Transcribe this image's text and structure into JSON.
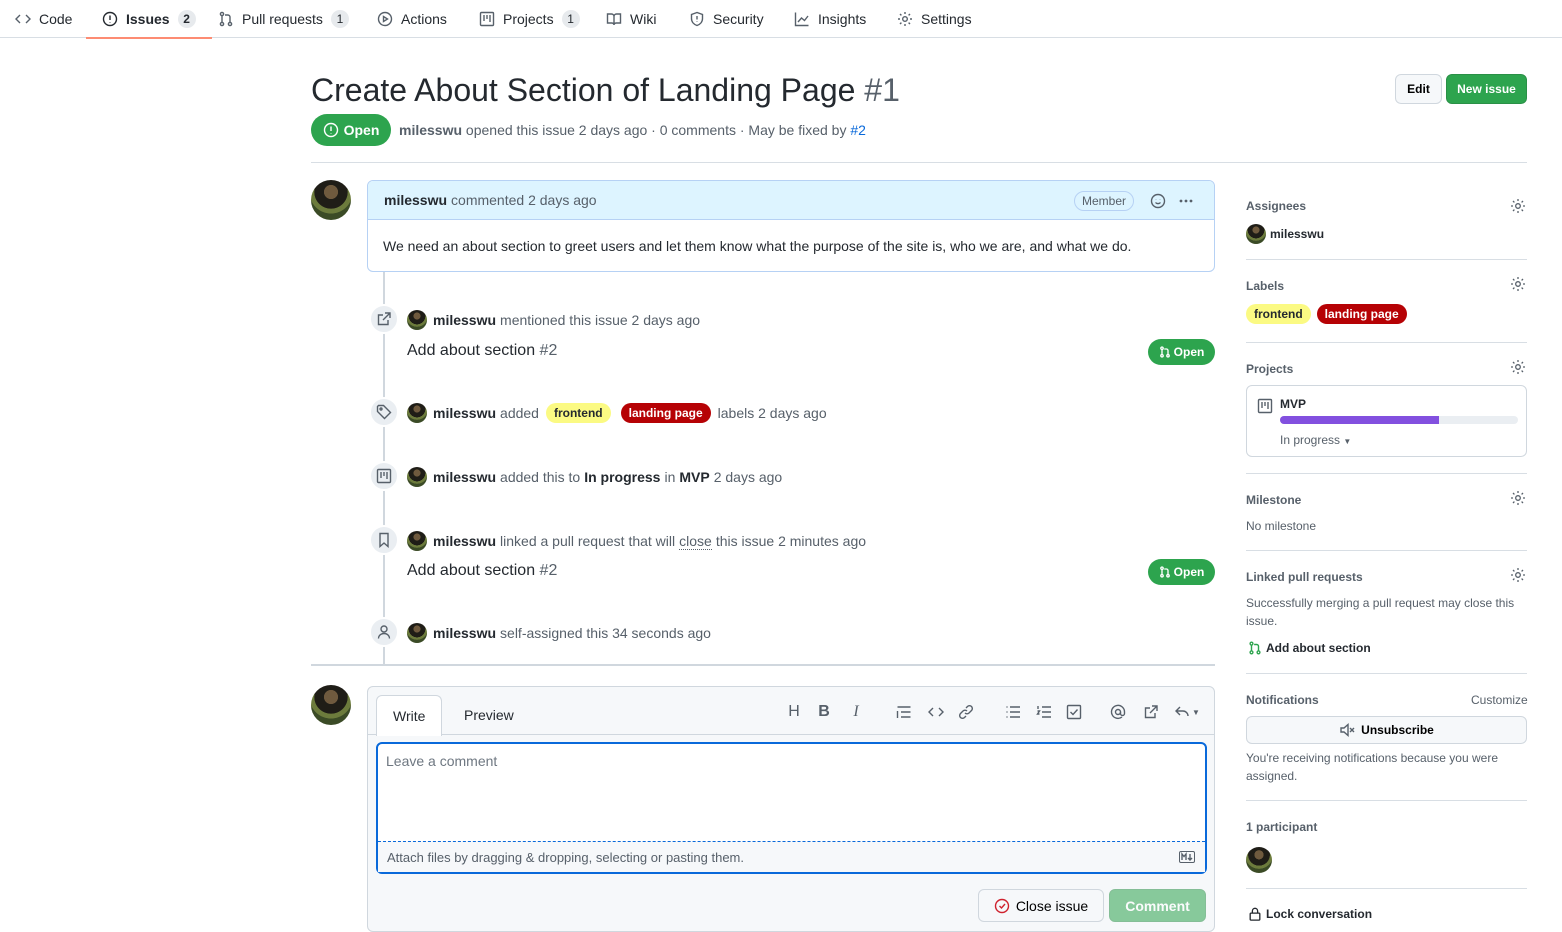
{
  "nav": {
    "tabs": [
      {
        "label": "Code",
        "icon": "code-icon"
      },
      {
        "label": "Issues",
        "count": "2",
        "icon": "issue-icon"
      },
      {
        "label": "Pull requests",
        "count": "1",
        "icon": "pull-request-icon"
      },
      {
        "label": "Actions",
        "icon": "play-icon"
      },
      {
        "label": "Projects",
        "count": "1",
        "icon": "project-icon"
      },
      {
        "label": "Wiki",
        "icon": "book-icon"
      },
      {
        "label": "Security",
        "icon": "shield-icon"
      },
      {
        "label": "Insights",
        "icon": "graph-icon"
      },
      {
        "label": "Settings",
        "icon": "gear-icon"
      }
    ]
  },
  "issue": {
    "title": "Create About Section of Landing Page",
    "number": "#1",
    "state": "Open",
    "author": "milesswu",
    "meta_text": "opened this issue 2 days ago · 0 comments · May be fixed by",
    "fixed_by": "#2",
    "edit_label": "Edit",
    "new_issue_label": "New issue"
  },
  "comment": {
    "author": "milesswu",
    "time": "commented 2 days ago",
    "role": "Member",
    "body": "We need an about section to greet users and let them know what the purpose of the site is, who we are, and what we do."
  },
  "timeline": {
    "mention": {
      "user": "milesswu",
      "text": "mentioned this issue 2 days ago",
      "ref_title": "Add about section",
      "ref_num": "#2",
      "state": "Open"
    },
    "labels": {
      "user": "milesswu",
      "text_a": "added",
      "text_b": "labels 2 days ago"
    },
    "project": {
      "user": "milesswu",
      "text_a": "added this to",
      "column": "In progress",
      "text_b": "in",
      "project": "MVP",
      "text_c": "2 days ago"
    },
    "linked": {
      "user": "milesswu",
      "text_a": "linked a pull request that will",
      "close_word": "close",
      "text_b": "this issue 2 minutes ago",
      "ref_title": "Add about section",
      "ref_num": "#2",
      "state": "Open"
    },
    "assigned": {
      "user": "milesswu",
      "text": "self-assigned this 34 seconds ago"
    }
  },
  "labels": {
    "frontend": "frontend",
    "landing": "landing page",
    "frontend_color": "#fbfa83",
    "landing_color": "#b60205"
  },
  "editor": {
    "tab_write": "Write",
    "tab_preview": "Preview",
    "placeholder": "Leave a comment",
    "attach_text": "Attach files by dragging & dropping, selecting or pasting them.",
    "heading_tool": "H",
    "bold_tool": "B",
    "italic_tool": "I",
    "close_issue": "Close issue",
    "comment_btn": "Comment"
  },
  "sidebar": {
    "assignees_h": "Assignees",
    "assignee": "milesswu",
    "labels_h": "Labels",
    "projects_h": "Projects",
    "project_name": "MVP",
    "project_status": "In progress",
    "project_progress": 0.67,
    "milestone_h": "Milestone",
    "milestone": "No milestone",
    "linked_h": "Linked pull requests",
    "linked_text": "Successfully merging a pull request may close this issue.",
    "linked_pr": "Add about section",
    "notifications_h": "Notifications",
    "customize": "Customize",
    "unsubscribe": "Unsubscribe",
    "notif_text": "You're receiving notifications because you were assigned.",
    "participants_h": "1 participant",
    "lock": "Lock conversation"
  },
  "colors": {
    "green": "#2da44e",
    "accent_underline": "#fd8c73",
    "progress": "#8250df",
    "link": "#0969da"
  }
}
